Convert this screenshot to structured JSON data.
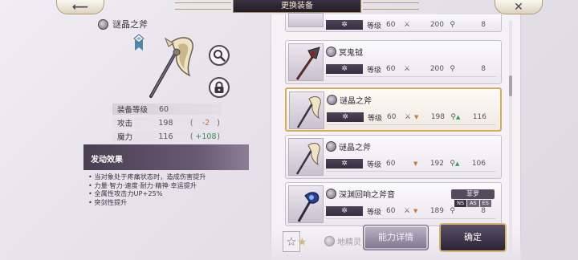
{
  "header": {
    "title": "更换装备",
    "back_icon": "arrow-left-icon",
    "close_icon": "close-x-icon"
  },
  "item_detail": {
    "name": "谜晶之斧",
    "stats": [
      {
        "label": "装备等级",
        "value": "60",
        "paren_open": "",
        "diff": "",
        "paren_close": "",
        "diff_type": "none"
      },
      {
        "label": "攻击",
        "value": "198",
        "paren_open": "(",
        "diff": "-2",
        "paren_close": ")",
        "diff_type": "neg"
      },
      {
        "label": "魔力",
        "value": "116",
        "paren_open": "(",
        "diff": "+108",
        "paren_close": ")",
        "diff_type": "pos"
      }
    ],
    "effect_title": "发动效果",
    "effect_lines": [
      "• 当对象处于疼痛状态时，造成伤害提升",
      "• 力量·智力·速度·耐力·精神·幸运提升",
      "• 全属性攻击力UP+25%",
      "• 突剑性提升"
    ]
  },
  "equipment_list": {
    "items": [
      {
        "name": "",
        "rune": "✲",
        "level_label": "等级",
        "level": "60",
        "atk": "200",
        "atk_trend": "",
        "mag": "8",
        "mag_trend": "",
        "selected": false
      },
      {
        "name": "冥鬼钺",
        "rune": "✲",
        "level_label": "等级",
        "level": "60",
        "atk": "200",
        "atk_trend": "",
        "mag": "8",
        "mag_trend": "",
        "selected": false
      },
      {
        "name": "谜晶之斧",
        "rune": "✲",
        "level_label": "等级",
        "level": "60",
        "atk": "198",
        "atk_trend": "▼",
        "mag": "116",
        "mag_trend": "▲",
        "selected": true
      },
      {
        "name": "谜晶之斧",
        "rune": "✲",
        "level_label": "等级",
        "level": "60",
        "atk": "192",
        "atk_trend": "▼",
        "mag": "106",
        "mag_trend": "▲",
        "selected": false
      },
      {
        "name": "深渊回响之斧音",
        "rune": "✲",
        "level_label": "等级",
        "level": "60",
        "atk": "189",
        "atk_trend": "▼",
        "mag": "8",
        "mag_trend": "",
        "selected": false,
        "tag": "菲罗",
        "tag_chips": [
          "NS",
          "AS",
          "ES"
        ]
      }
    ],
    "ghost_item_name": "地精灵"
  },
  "buttons": {
    "detail": "能力详情",
    "confirm": "确定"
  },
  "colors": {
    "accent_gold": "#d6ac5c",
    "positive": "#3a8a55",
    "negative": "#b7743a",
    "dark_panel": "#4a3e52"
  }
}
